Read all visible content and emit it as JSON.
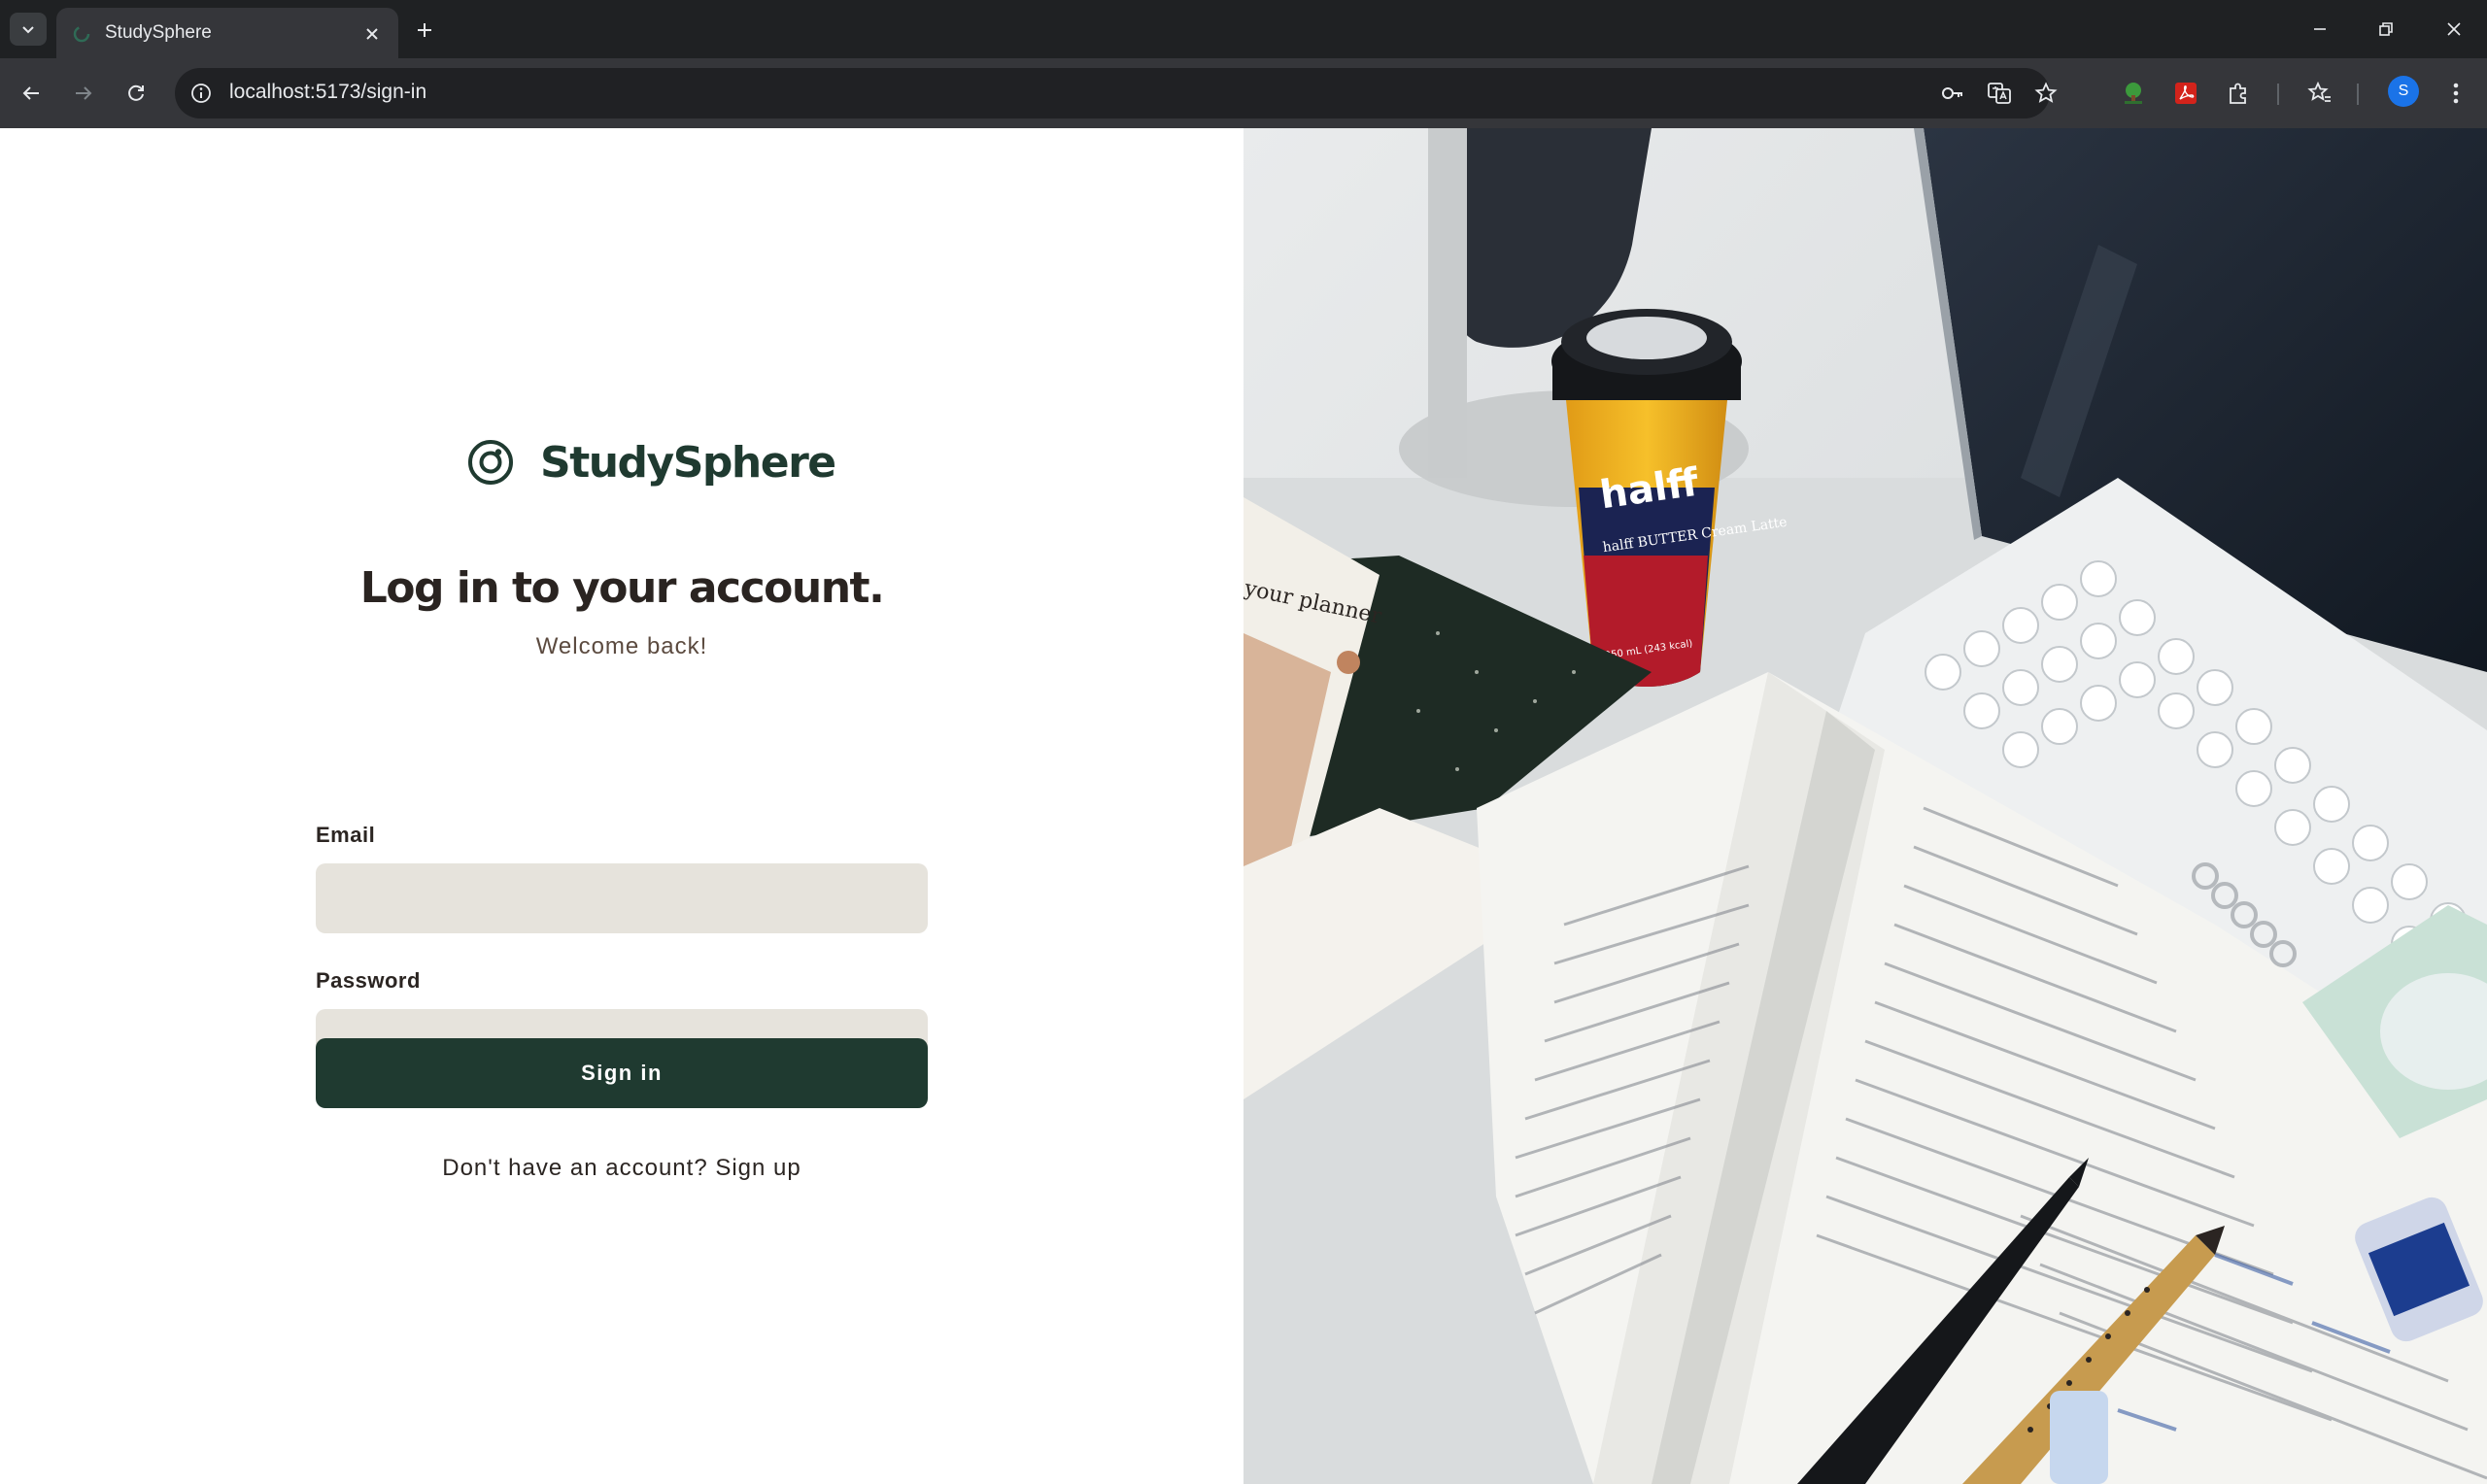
{
  "browser": {
    "tab_title": "StudySphere",
    "url": "localhost:5173/sign-in",
    "profile_initial": "S"
  },
  "brand": {
    "name": "StudySphere",
    "color": "#1f3a30"
  },
  "login": {
    "heading": "Log in to your account.",
    "subheading": "Welcome back!",
    "email_label": "Email",
    "email_value": "",
    "password_label": "Password",
    "password_value": "",
    "submit_label": "Sign in",
    "signup_prompt": "Don't have an account?",
    "signup_link": "Sign up"
  },
  "hero_image": {
    "cup_text": "halff",
    "cup_subtext": "halff BUTTER Cream Latte",
    "cup_volume": "250 mL (243 kcal)",
    "planner_text": "your planner"
  },
  "colors": {
    "primary": "#1f3a30",
    "input_bg": "#e6e3dc",
    "heading": "#2a2421"
  }
}
